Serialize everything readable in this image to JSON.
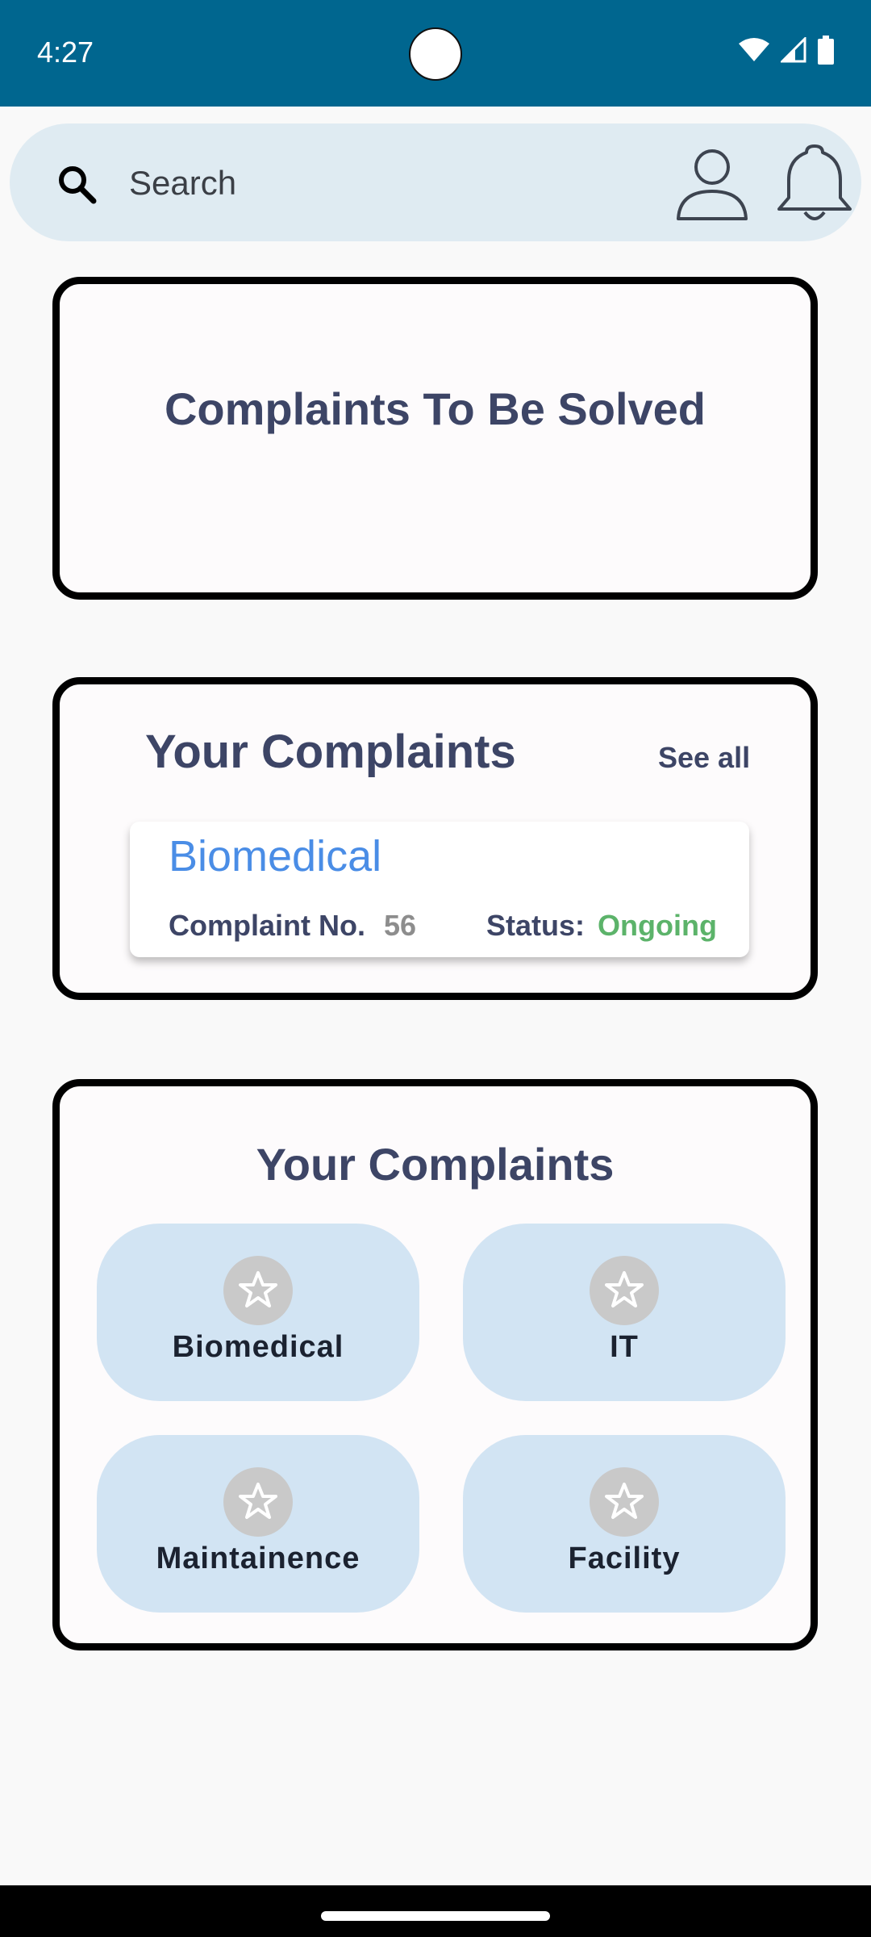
{
  "status_bar": {
    "time": "4:27",
    "icons": [
      "wifi-icon",
      "signal-icon",
      "battery-icon"
    ]
  },
  "search": {
    "placeholder": "Search",
    "icons": [
      "search-icon",
      "profile-icon",
      "bell-icon"
    ]
  },
  "card_to_solve": {
    "title": "Complaints To Be Solved"
  },
  "your_complaints": {
    "title": "Your Complaints",
    "see_all": "See all",
    "item": {
      "category": "Biomedical",
      "complaint_no_label": "Complaint No.",
      "complaint_no": "56",
      "status_label": "Status:",
      "status": "Ongoing"
    }
  },
  "categories_card": {
    "title": "Your Complaints",
    "buttons": [
      {
        "label": "Biomedical",
        "icon": "star-icon"
      },
      {
        "label": "IT",
        "icon": "star-icon"
      },
      {
        "label": "Maintainence",
        "icon": "star-icon"
      },
      {
        "label": "Facility",
        "icon": "star-icon"
      }
    ]
  },
  "colors": {
    "status_bar": "#00668f",
    "search_bg": "#dfebf2",
    "heading": "#3d4566",
    "category_link": "#4a8de6",
    "status_ongoing": "#5cb36a",
    "tile_bg": "#d2e4f3"
  }
}
